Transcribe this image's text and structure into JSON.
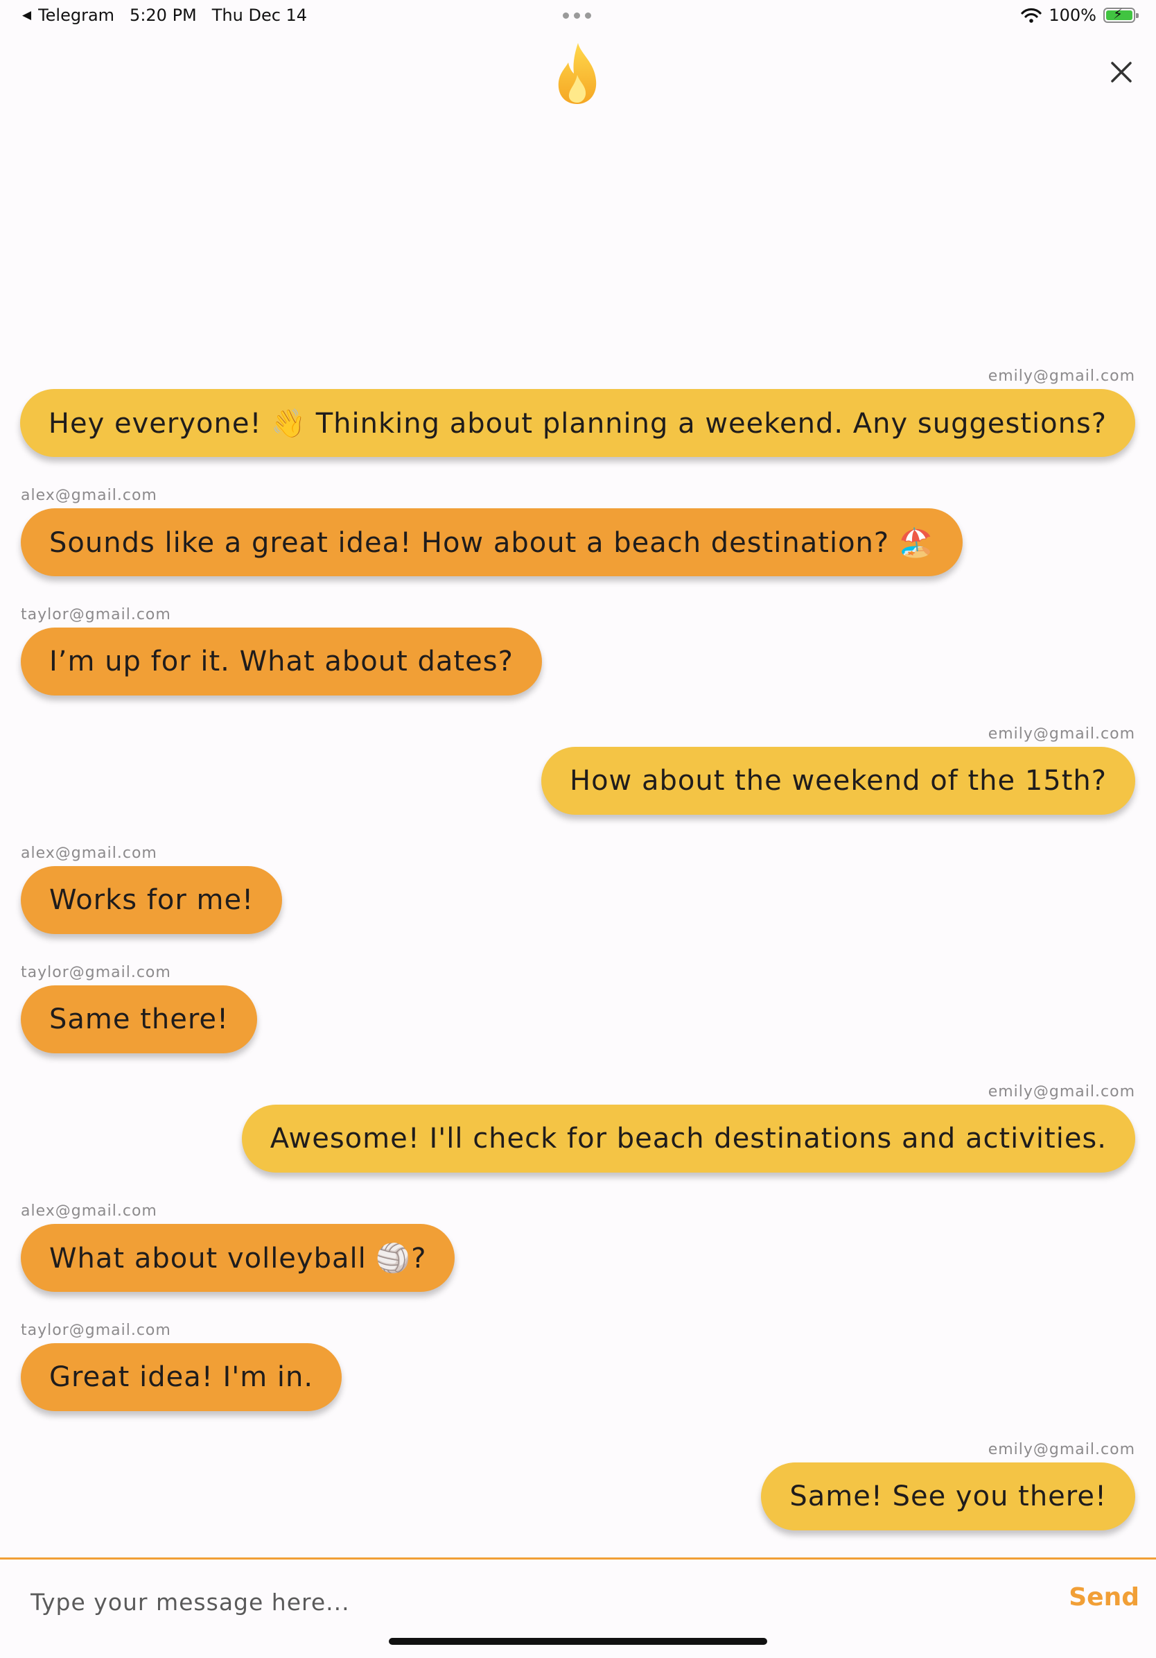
{
  "status_bar": {
    "back_app": "Telegram",
    "time": "5:20 PM",
    "date": "Thu Dec 14",
    "battery": "100%"
  },
  "header": {
    "logo_icon": "flame-icon",
    "close_icon": "close-icon"
  },
  "colors": {
    "own_bubble": "#f4c445",
    "other_bubble": "#f19f36",
    "accent": "#f19f36"
  },
  "messages": [
    {
      "sender": "emily@gmail.com",
      "text": "Hey everyone! 👋 Thinking about planning a weekend. Any suggestions?",
      "side": "right"
    },
    {
      "sender": "alex@gmail.com",
      "text": "Sounds like a great idea! How about a beach destination? 🏖️",
      "side": "left"
    },
    {
      "sender": "taylor@gmail.com",
      "text": "I’m up for it. What about dates?",
      "side": "left"
    },
    {
      "sender": "emily@gmail.com",
      "text": "How about the weekend of the 15th?",
      "side": "right"
    },
    {
      "sender": "alex@gmail.com",
      "text": "Works for me!",
      "side": "left"
    },
    {
      "sender": "taylor@gmail.com",
      "text": "Same there!",
      "side": "left"
    },
    {
      "sender": "emily@gmail.com",
      "text": "Awesome! I'll check for beach destinations and activities.",
      "side": "right"
    },
    {
      "sender": "alex@gmail.com",
      "text": "What about volleyball 🏐?",
      "side": "left"
    },
    {
      "sender": "taylor@gmail.com",
      "text": "Great idea! I'm in.",
      "side": "left"
    },
    {
      "sender": "emily@gmail.com",
      "text": "Same! See you there!",
      "side": "right"
    }
  ],
  "input": {
    "placeholder": "Type your message here...",
    "value": ""
  },
  "send_label": "Send"
}
